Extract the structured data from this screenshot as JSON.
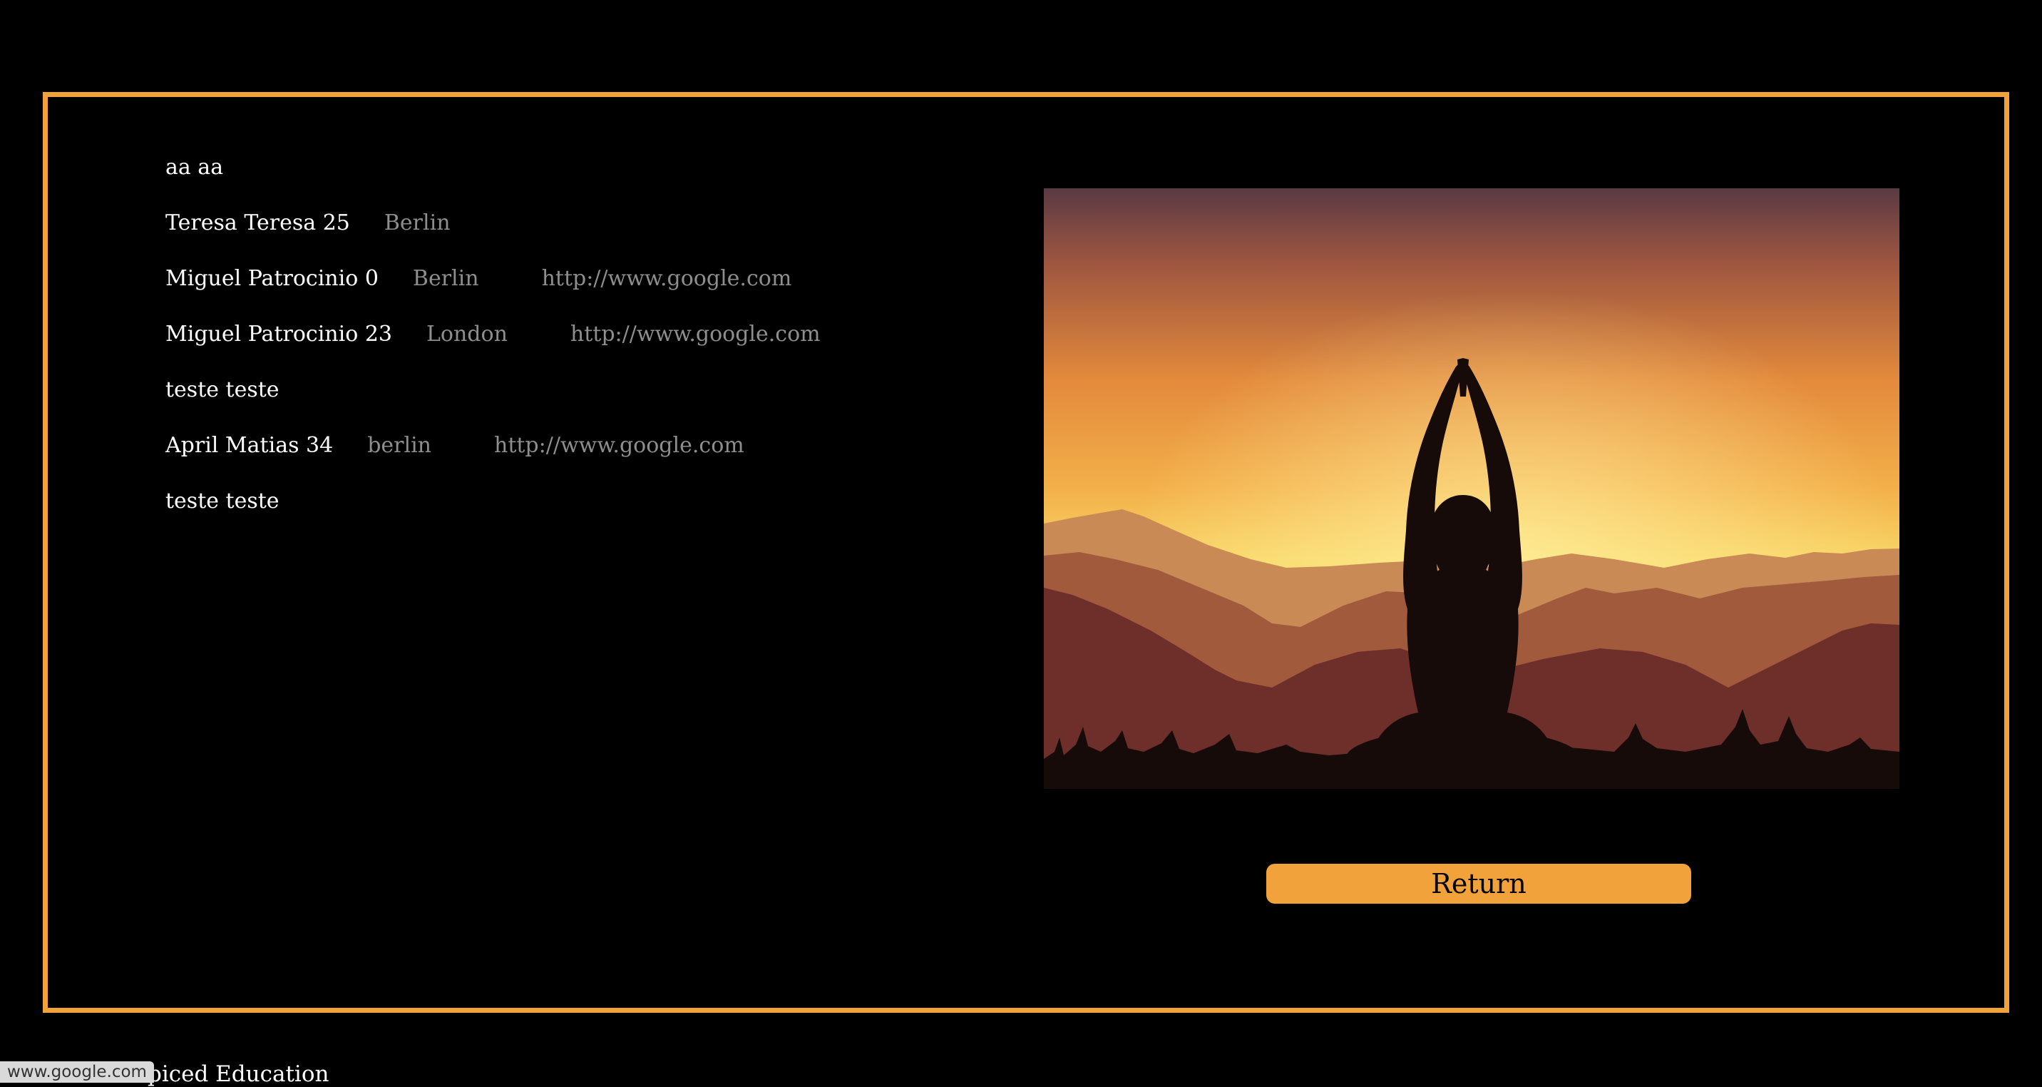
{
  "people": [
    {
      "name": "aa aa",
      "city": "",
      "link": ""
    },
    {
      "name": "Teresa Teresa 25",
      "city": "Berlin",
      "link": ""
    },
    {
      "name": "Miguel Patrocinio 0",
      "city": "Berlin",
      "link": "http://www.google.com"
    },
    {
      "name": "Miguel Patrocinio 23",
      "city": "London",
      "link": "http://www.google.com"
    },
    {
      "name": "teste teste",
      "city": "",
      "link": ""
    },
    {
      "name": "April Matias 34",
      "city": "berlin",
      "link": "http://www.google.com"
    },
    {
      "name": "teste teste",
      "city": "",
      "link": ""
    }
  ],
  "image": {
    "subject": "yoga-silhouette-sunset",
    "colors": {
      "sky_top": "#5a3a44",
      "sky_mid": "#e38a3c",
      "sky_glow": "#f8d766",
      "mountain_far": "#c98a55",
      "mountain_mid": "#a25a3d",
      "mountain_near": "#6e2e2a",
      "silhouette": "#170b0a"
    }
  },
  "return_button": {
    "label": "Return"
  },
  "footer": {
    "text": "piced Education"
  },
  "status_bar": {
    "url": "www.google.com"
  },
  "theme": {
    "accent": "#f2a23a",
    "background": "#000000",
    "muted_text": "#8e8e8e"
  }
}
